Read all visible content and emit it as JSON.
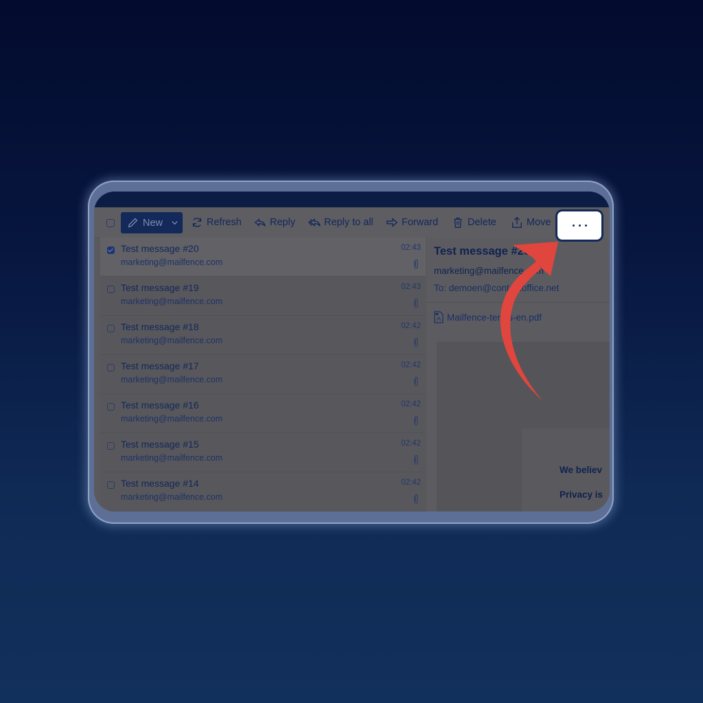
{
  "toolbar": {
    "new_label": "New",
    "refresh_label": "Refresh",
    "reply_label": "Reply",
    "reply_all_label": "Reply to all",
    "forward_label": "Forward",
    "delete_label": "Delete",
    "move_label": "Move",
    "more_label": "..."
  },
  "messages": [
    {
      "subject": "Test message #20",
      "from": "marketing@mailfence.com",
      "time": "02:43",
      "selected": true,
      "has_attachment": true
    },
    {
      "subject": "Test message #19",
      "from": "marketing@mailfence.com",
      "time": "02:43",
      "selected": false,
      "has_attachment": true
    },
    {
      "subject": "Test message #18",
      "from": "marketing@mailfence.com",
      "time": "02:42",
      "selected": false,
      "has_attachment": true
    },
    {
      "subject": "Test message #17",
      "from": "marketing@mailfence.com",
      "time": "02:42",
      "selected": false,
      "has_attachment": true
    },
    {
      "subject": "Test message #16",
      "from": "marketing@mailfence.com",
      "time": "02:42",
      "selected": false,
      "has_attachment": true
    },
    {
      "subject": "Test message #15",
      "from": "marketing@mailfence.com",
      "time": "02:42",
      "selected": false,
      "has_attachment": true
    },
    {
      "subject": "Test message #14",
      "from": "marketing@mailfence.com",
      "time": "02:42",
      "selected": false,
      "has_attachment": true
    }
  ],
  "reader": {
    "subject": "Test message #20",
    "sender": "marketing@mailfence.com",
    "to": "To: demoen@contactoffice.net",
    "attachment": "Mailfence-terms-en.pdf",
    "body_line1": "We believ",
    "body_line2": "Privacy is"
  },
  "colors": {
    "accent": "#12295a",
    "annotation_arrow": "#e0463e",
    "highlight_button": "#ffffff"
  }
}
